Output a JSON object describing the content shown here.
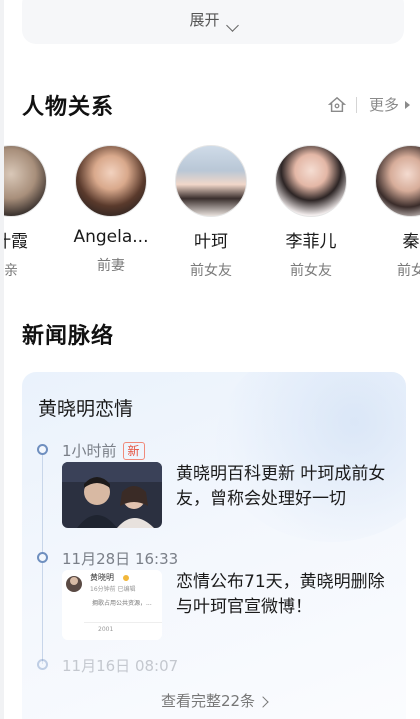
{
  "expand": {
    "label": "展开"
  },
  "relations": {
    "title": "人物关系",
    "more_label": "更多",
    "people": [
      {
        "name": "叶霞",
        "relation": "亲"
      },
      {
        "name": "Angela...",
        "relation": "前妻"
      },
      {
        "name": "叶珂",
        "relation": "前女友"
      },
      {
        "name": "李菲儿",
        "relation": "前女友"
      },
      {
        "name": "秦",
        "relation": "前女"
      }
    ]
  },
  "news": {
    "title": "新闻脉络",
    "card_title": "黄晓明恋情",
    "items": [
      {
        "time": "1小时前",
        "badge": "新",
        "text": "黄晓明百科更新 叶珂成前女友，曾称会处理好一切"
      },
      {
        "time": "11月28日 16:33",
        "text": "恋情公布71天，黄晓明删除与叶珂官宣微博！",
        "thumb_user": "黄晓明",
        "thumb_meta": "16分钟前 已编辑",
        "thumb_body": "拥歌占用公共资源，...",
        "thumb_count": "2001"
      },
      {
        "time": "11月16日 08:07"
      }
    ],
    "see_all": "查看完整22条"
  },
  "colors": {
    "accent": "#6f8fbf",
    "badge": "#e5503c"
  }
}
